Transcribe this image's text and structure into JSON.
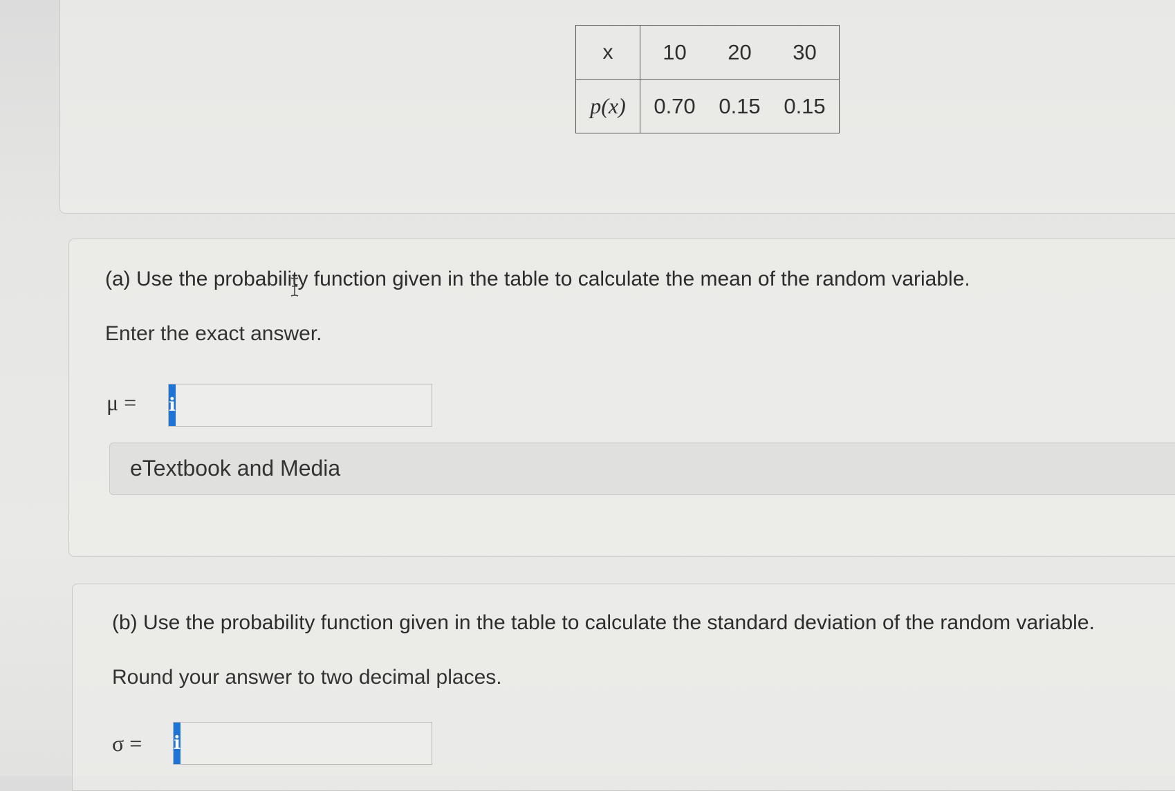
{
  "table": {
    "header_label": "x",
    "x_values": [
      "10",
      "20",
      "30"
    ],
    "prob_label": "p(x)",
    "prob_values": [
      "0.70",
      "0.15",
      "0.15"
    ]
  },
  "part_a": {
    "question": "(a) Use the probability function given in the table to calculate the mean of the random variable.",
    "instruction": "Enter the exact answer.",
    "symbol": "μ =",
    "info_icon": "i",
    "answer_value": "",
    "media_label": "eTextbook and Media"
  },
  "part_b": {
    "question": "(b) Use the probability function given in the table to calculate the standard deviation of the random variable.",
    "instruction": "Round your answer to two decimal places.",
    "symbol": "σ =",
    "info_icon": "i",
    "answer_value": ""
  },
  "colors": {
    "info_button": "#1d74d6",
    "background": "#e6e6e4",
    "text": "#2e2e2e"
  },
  "icons": {
    "info": "info-icon",
    "cursor": "text-cursor-icon"
  }
}
